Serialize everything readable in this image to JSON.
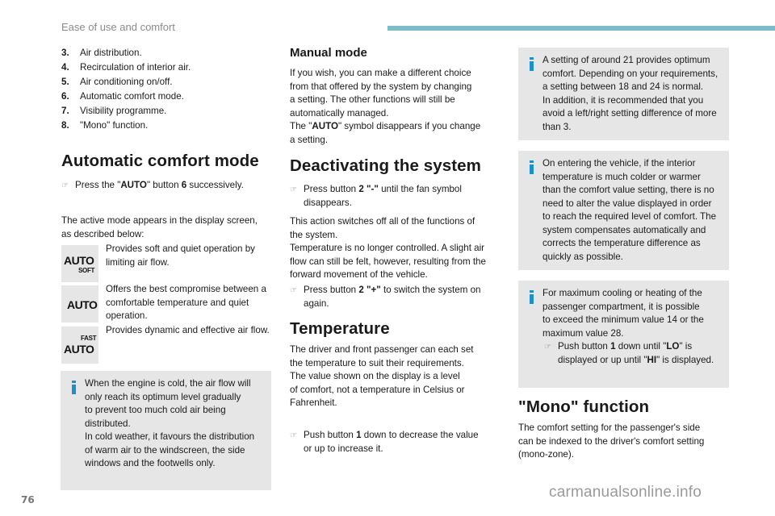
{
  "header": {
    "section_title": "Ease of use and comfort",
    "accent_color": "#7fbcc9"
  },
  "column1": {
    "numbered_list": [
      {
        "num": "3.",
        "text": "Air distribution."
      },
      {
        "num": "4.",
        "text": "Recirculation of interior air."
      },
      {
        "num": "5.",
        "text": "Air conditioning on/off."
      },
      {
        "num": "6.",
        "text": "Automatic comfort mode."
      },
      {
        "num": "7.",
        "text": "Visibility programme."
      },
      {
        "num": "8.",
        "text": "\"Mono\" function."
      }
    ],
    "auto_heading": "Automatic comfort mode",
    "auto_bullet": {
      "icon": "pointing-hand-icon",
      "pre": "Press the \"",
      "bold1": "AUTO",
      "mid": "\" button ",
      "bold2": "6",
      "post": " successively."
    },
    "auto_intro_line1": "The active mode appears in the display screen,",
    "auto_intro_line2": "as described below:",
    "modes": [
      {
        "icon_main": "AUTO",
        "icon_sub": "SOFT",
        "description": "Provides soft and quiet operation by limiting air flow."
      },
      {
        "icon_main": "AUTO",
        "icon_sub": "",
        "description": "Offers the best compromise between a comfortable temperature and quiet operation."
      },
      {
        "icon_main": "AUTO",
        "icon_sub": "FAST",
        "description": "Provides dynamic and effective air flow."
      }
    ],
    "info_box": {
      "icon": "info-icon",
      "lines": [
        "When the engine is cold, the air flow will",
        "only reach its optimum level gradually",
        "to prevent too much cold air being",
        "distributed.",
        "In cold weather, it favours the distribution",
        "of warm air to the windscreen, the side",
        "windows and the footwells only."
      ]
    }
  },
  "column2": {
    "manual_heading": "Manual mode",
    "manual_lines": [
      "If you wish, you can make a different choice",
      "from that offered by the system by changing",
      "a setting. The other functions will still be",
      "automatically managed."
    ],
    "manual_auto_pre": "The \"",
    "manual_auto_bold": "AUTO",
    "manual_auto_post": "\" symbol disappears if you change",
    "manual_auto_line2": "a setting.",
    "deact_heading": "Deactivating the system",
    "deact_bullet1": {
      "pre": "Press button ",
      "bold": "2 \"-\"",
      "post": " until the fan symbol",
      "line2": "disappears."
    },
    "deact_lines": [
      "This action switches off all of the functions of",
      "the system.",
      "Temperature is no longer controlled. A slight air",
      "flow can still be felt, however, resulting from the",
      "forward movement of the vehicle."
    ],
    "deact_bullet2": {
      "pre": "Press button ",
      "bold": "2 \"+\"",
      "post": " to switch the system on",
      "line2": "again."
    },
    "temp_heading": "Temperature",
    "temp_lines": [
      "The driver and front passenger can each set",
      "the temperature to suit their requirements.",
      "The value shown on the display is a level",
      "of comfort, not a temperature in Celsius or",
      "Fahrenheit."
    ],
    "temp_bullet": {
      "pre": "Push button ",
      "bold": "1",
      "post": " down to decrease the value",
      "line2": "or up to increase it."
    }
  },
  "column3": {
    "info1": [
      "A setting of around 21 provides optimum",
      "comfort. Depending on your requirements,",
      "a setting between 18 and 24 is normal.",
      "In addition, it is recommended that you",
      "avoid a left/right setting difference of more",
      "than 3."
    ],
    "info2": [
      "On entering the vehicle, if the interior",
      "temperature is much colder or warmer",
      "than the comfort value setting, there is no",
      "need to alter the value displayed in order",
      "to reach the required level of comfort. The",
      "system compensates automatically and",
      "corrects the temperature difference as",
      "quickly as possible."
    ],
    "info3": [
      "For maximum cooling or heating of the",
      "passenger compartment, it is possible",
      "to exceed the minimum value 14 or the",
      "maximum value 28."
    ],
    "info3_bullet": {
      "pre": "Push button ",
      "bold1": "1",
      "mid": " down until \"",
      "bold2": "LO",
      "post": "\" is",
      "line2_pre": "displayed or up until \"",
      "line2_bold": "HI",
      "line2_post": "\" is displayed."
    },
    "mono_heading": "\"Mono\" function",
    "mono_lines": [
      "The comfort setting for the passenger's side",
      "can be indexed to the driver's comfort setting",
      "(mono-zone)."
    ]
  },
  "footer": {
    "page_number": "76",
    "watermark": "carmanualsonline.info"
  },
  "bullet_glyph": "☞"
}
